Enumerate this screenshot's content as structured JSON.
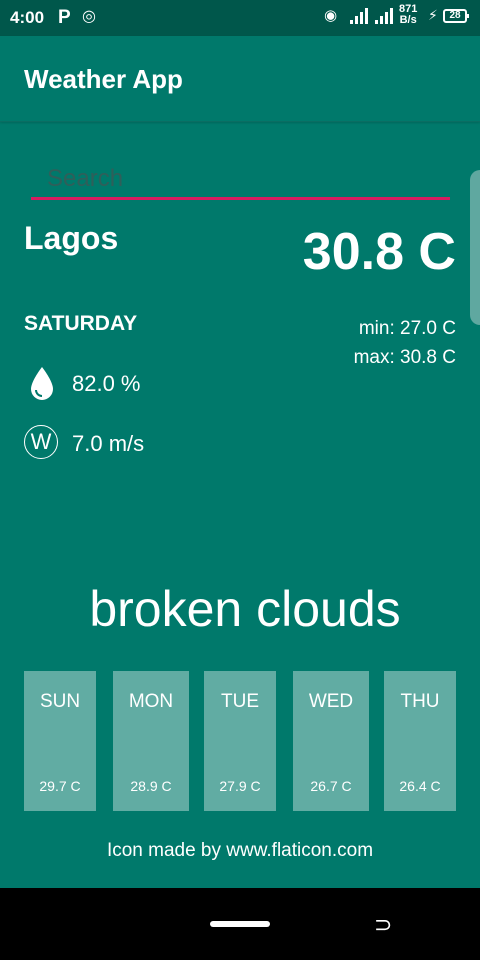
{
  "status": {
    "time": "4:00",
    "net_speed_top": "871",
    "net_speed_bottom": "B/s",
    "battery": "28"
  },
  "app": {
    "title": "Weather App"
  },
  "search": {
    "placeholder": "Search"
  },
  "weather": {
    "city": "Lagos",
    "temperature": "30.8 C",
    "day": "SATURDAY",
    "min": "min: 27.0 C",
    "max": "max: 30.8 C",
    "humidity": "82.0 %",
    "wind": "7.0 m/s",
    "description": "broken clouds"
  },
  "forecast": [
    {
      "day": "SUN",
      "temp": "29.7 C"
    },
    {
      "day": "MON",
      "temp": "28.9 C"
    },
    {
      "day": "TUE",
      "temp": "27.9 C"
    },
    {
      "day": "WED",
      "temp": "26.7 C"
    },
    {
      "day": "THU",
      "temp": "26.4 C"
    }
  ],
  "footer": {
    "credit": "Icon made by www.flaticon.com"
  },
  "colors": {
    "background": "#00796B",
    "status_bar": "#00574B",
    "accent": "#D81B60"
  }
}
